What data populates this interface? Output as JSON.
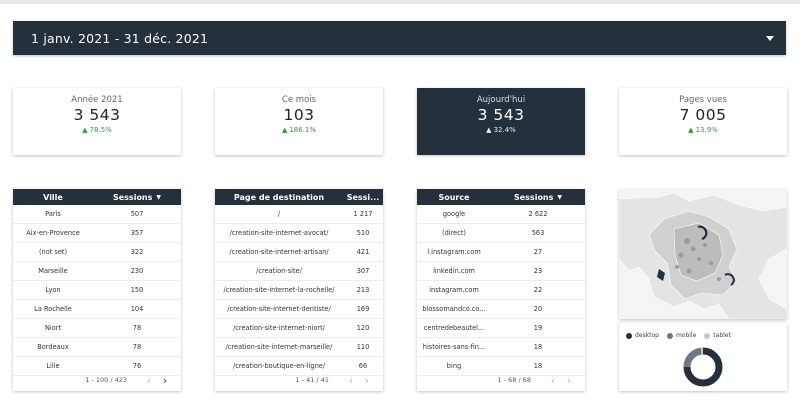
{
  "date_range": {
    "label": "1 janv. 2021 - 31 déc. 2021"
  },
  "kpis": [
    {
      "label": "Année 2021",
      "value": "3 543",
      "delta": "78.5%",
      "dark": false
    },
    {
      "label": "Ce mois",
      "value": "103",
      "delta": "186.1%",
      "dark": false
    },
    {
      "label": "Aujourd'hui",
      "value": "3 543",
      "delta": "32.4%",
      "dark": true
    },
    {
      "label": "Pages vues",
      "value": "7 005",
      "delta": "13.9%",
      "dark": false
    }
  ],
  "tables": [
    {
      "col1": "Ville",
      "col2": "Sessions",
      "sort_icon": "sort-desc-icon",
      "rows": [
        [
          "Paris",
          "507"
        ],
        [
          "Aix-en-Provence",
          "357"
        ],
        [
          "(not set)",
          "322"
        ],
        [
          "Marseille",
          "230"
        ],
        [
          "Lyon",
          "150"
        ],
        [
          "La Rochelle",
          "104"
        ],
        [
          "Niort",
          "78"
        ],
        [
          "Bordeaux",
          "78"
        ],
        [
          "Lille",
          "76"
        ]
      ],
      "pager": "1 - 100 / 423"
    },
    {
      "col1": "Page de destination",
      "col2": "Sessi...",
      "rows": [
        [
          "/",
          "1 217"
        ],
        [
          "/creation-site-internet-avocat/",
          "510"
        ],
        [
          "/creation-site-internet-artisan/",
          "421"
        ],
        [
          "/creation-site/",
          "307"
        ],
        [
          "/creation-site-internet-la-rochelle/",
          "213"
        ],
        [
          "/creation-site-internet-dentiste/",
          "169"
        ],
        [
          "/creation-site-internet-niort/",
          "120"
        ],
        [
          "/creation-site-internet-marseille/",
          "110"
        ],
        [
          "/creation-boutique-en-ligne/",
          "66"
        ]
      ],
      "pager": "1 - 41 / 41"
    },
    {
      "col1": "Source",
      "col2": "Sessions",
      "sort_icon": "sort-desc-icon",
      "rows": [
        [
          "google",
          "2 622"
        ],
        [
          "(direct)",
          "563"
        ],
        [
          "l.instagram.com",
          "27"
        ],
        [
          "linkedin.com",
          "23"
        ],
        [
          "instagram.com",
          "22"
        ],
        [
          "blossomandco.co...",
          "20"
        ],
        [
          "centredebeautel...",
          "19"
        ],
        [
          "histoires-sans-fin...",
          "18"
        ],
        [
          "bing",
          "18"
        ]
      ],
      "pager": "1 - 68 / 68"
    }
  ],
  "device_chart": {
    "legend": [
      {
        "name": "desktop",
        "color": "#25303d"
      },
      {
        "name": "mobile",
        "color": "#6f7780"
      },
      {
        "name": "tablet",
        "color": "#c4c8cc"
      }
    ],
    "shares": [
      0.75,
      0.23,
      0.02
    ]
  },
  "colors": {
    "dark": "#25303d",
    "positive": "#2e9e3e"
  }
}
